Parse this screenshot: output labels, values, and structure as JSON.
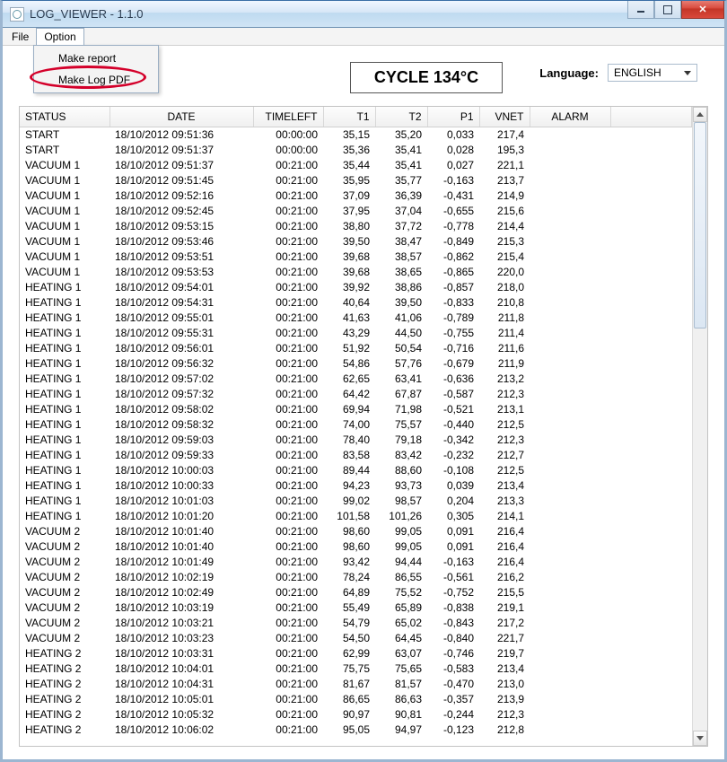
{
  "app": {
    "title": "LOG_VIEWER - 1.1.0"
  },
  "menu": {
    "file": "File",
    "option": "Option",
    "dropdown": {
      "make_report": "Make report",
      "make_log_pdf": "Make Log PDF"
    }
  },
  "header": {
    "cycle_label": "CYCLE 134°C",
    "language_label": "Language:",
    "language_value": "ENGLISH"
  },
  "columns": {
    "status": "STATUS",
    "date": "DATE",
    "timeleft": "TIMELEFT",
    "t1": "T1",
    "t2": "T2",
    "p1": "P1",
    "vnet": "VNET",
    "alarm": "ALARM"
  },
  "rows": [
    {
      "status": "START",
      "date": "18/10/2012 09:51:36",
      "timeleft": "00:00:00",
      "t1": "35,15",
      "t2": "35,20",
      "p1": "0,033",
      "vnet": "217,4",
      "alarm": ""
    },
    {
      "status": "START",
      "date": "18/10/2012 09:51:37",
      "timeleft": "00:00:00",
      "t1": "35,36",
      "t2": "35,41",
      "p1": "0,028",
      "vnet": "195,3",
      "alarm": ""
    },
    {
      "status": "VACUUM 1",
      "date": "18/10/2012 09:51:37",
      "timeleft": "00:21:00",
      "t1": "35,44",
      "t2": "35,41",
      "p1": "0,027",
      "vnet": "221,1",
      "alarm": ""
    },
    {
      "status": "VACUUM 1",
      "date": "18/10/2012 09:51:45",
      "timeleft": "00:21:00",
      "t1": "35,95",
      "t2": "35,77",
      "p1": "-0,163",
      "vnet": "213,7",
      "alarm": ""
    },
    {
      "status": "VACUUM 1",
      "date": "18/10/2012 09:52:16",
      "timeleft": "00:21:00",
      "t1": "37,09",
      "t2": "36,39",
      "p1": "-0,431",
      "vnet": "214,9",
      "alarm": ""
    },
    {
      "status": "VACUUM 1",
      "date": "18/10/2012 09:52:45",
      "timeleft": "00:21:00",
      "t1": "37,95",
      "t2": "37,04",
      "p1": "-0,655",
      "vnet": "215,6",
      "alarm": ""
    },
    {
      "status": "VACUUM 1",
      "date": "18/10/2012 09:53:15",
      "timeleft": "00:21:00",
      "t1": "38,80",
      "t2": "37,72",
      "p1": "-0,778",
      "vnet": "214,4",
      "alarm": ""
    },
    {
      "status": "VACUUM 1",
      "date": "18/10/2012 09:53:46",
      "timeleft": "00:21:00",
      "t1": "39,50",
      "t2": "38,47",
      "p1": "-0,849",
      "vnet": "215,3",
      "alarm": ""
    },
    {
      "status": "VACUUM 1",
      "date": "18/10/2012 09:53:51",
      "timeleft": "00:21:00",
      "t1": "39,68",
      "t2": "38,57",
      "p1": "-0,862",
      "vnet": "215,4",
      "alarm": ""
    },
    {
      "status": "VACUUM 1",
      "date": "18/10/2012 09:53:53",
      "timeleft": "00:21:00",
      "t1": "39,68",
      "t2": "38,65",
      "p1": "-0,865",
      "vnet": "220,0",
      "alarm": ""
    },
    {
      "status": "HEATING 1",
      "date": "18/10/2012 09:54:01",
      "timeleft": "00:21:00",
      "t1": "39,92",
      "t2": "38,86",
      "p1": "-0,857",
      "vnet": "218,0",
      "alarm": ""
    },
    {
      "status": "HEATING 1",
      "date": "18/10/2012 09:54:31",
      "timeleft": "00:21:00",
      "t1": "40,64",
      "t2": "39,50",
      "p1": "-0,833",
      "vnet": "210,8",
      "alarm": ""
    },
    {
      "status": "HEATING 1",
      "date": "18/10/2012 09:55:01",
      "timeleft": "00:21:00",
      "t1": "41,63",
      "t2": "41,06",
      "p1": "-0,789",
      "vnet": "211,8",
      "alarm": ""
    },
    {
      "status": "HEATING 1",
      "date": "18/10/2012 09:55:31",
      "timeleft": "00:21:00",
      "t1": "43,29",
      "t2": "44,50",
      "p1": "-0,755",
      "vnet": "211,4",
      "alarm": ""
    },
    {
      "status": "HEATING 1",
      "date": "18/10/2012 09:56:01",
      "timeleft": "00:21:00",
      "t1": "51,92",
      "t2": "50,54",
      "p1": "-0,716",
      "vnet": "211,6",
      "alarm": ""
    },
    {
      "status": "HEATING 1",
      "date": "18/10/2012 09:56:32",
      "timeleft": "00:21:00",
      "t1": "54,86",
      "t2": "57,76",
      "p1": "-0,679",
      "vnet": "211,9",
      "alarm": ""
    },
    {
      "status": "HEATING 1",
      "date": "18/10/2012 09:57:02",
      "timeleft": "00:21:00",
      "t1": "62,65",
      "t2": "63,41",
      "p1": "-0,636",
      "vnet": "213,2",
      "alarm": ""
    },
    {
      "status": "HEATING 1",
      "date": "18/10/2012 09:57:32",
      "timeleft": "00:21:00",
      "t1": "64,42",
      "t2": "67,87",
      "p1": "-0,587",
      "vnet": "212,3",
      "alarm": ""
    },
    {
      "status": "HEATING 1",
      "date": "18/10/2012 09:58:02",
      "timeleft": "00:21:00",
      "t1": "69,94",
      "t2": "71,98",
      "p1": "-0,521",
      "vnet": "213,1",
      "alarm": ""
    },
    {
      "status": "HEATING 1",
      "date": "18/10/2012 09:58:32",
      "timeleft": "00:21:00",
      "t1": "74,00",
      "t2": "75,57",
      "p1": "-0,440",
      "vnet": "212,5",
      "alarm": ""
    },
    {
      "status": "HEATING 1",
      "date": "18/10/2012 09:59:03",
      "timeleft": "00:21:00",
      "t1": "78,40",
      "t2": "79,18",
      "p1": "-0,342",
      "vnet": "212,3",
      "alarm": ""
    },
    {
      "status": "HEATING 1",
      "date": "18/10/2012 09:59:33",
      "timeleft": "00:21:00",
      "t1": "83,58",
      "t2": "83,42",
      "p1": "-0,232",
      "vnet": "212,7",
      "alarm": ""
    },
    {
      "status": "HEATING 1",
      "date": "18/10/2012 10:00:03",
      "timeleft": "00:21:00",
      "t1": "89,44",
      "t2": "88,60",
      "p1": "-0,108",
      "vnet": "212,5",
      "alarm": ""
    },
    {
      "status": "HEATING 1",
      "date": "18/10/2012 10:00:33",
      "timeleft": "00:21:00",
      "t1": "94,23",
      "t2": "93,73",
      "p1": "0,039",
      "vnet": "213,4",
      "alarm": ""
    },
    {
      "status": "HEATING 1",
      "date": "18/10/2012 10:01:03",
      "timeleft": "00:21:00",
      "t1": "99,02",
      "t2": "98,57",
      "p1": "0,204",
      "vnet": "213,3",
      "alarm": ""
    },
    {
      "status": "HEATING 1",
      "date": "18/10/2012 10:01:20",
      "timeleft": "00:21:00",
      "t1": "101,58",
      "t2": "101,26",
      "p1": "0,305",
      "vnet": "214,1",
      "alarm": ""
    },
    {
      "status": "VACUUM 2",
      "date": "18/10/2012 10:01:40",
      "timeleft": "00:21:00",
      "t1": "98,60",
      "t2": "99,05",
      "p1": "0,091",
      "vnet": "216,4",
      "alarm": ""
    },
    {
      "status": "VACUUM 2",
      "date": "18/10/2012 10:01:40",
      "timeleft": "00:21:00",
      "t1": "98,60",
      "t2": "99,05",
      "p1": "0,091",
      "vnet": "216,4",
      "alarm": ""
    },
    {
      "status": "VACUUM 2",
      "date": "18/10/2012 10:01:49",
      "timeleft": "00:21:00",
      "t1": "93,42",
      "t2": "94,44",
      "p1": "-0,163",
      "vnet": "216,4",
      "alarm": ""
    },
    {
      "status": "VACUUM 2",
      "date": "18/10/2012 10:02:19",
      "timeleft": "00:21:00",
      "t1": "78,24",
      "t2": "86,55",
      "p1": "-0,561",
      "vnet": "216,2",
      "alarm": ""
    },
    {
      "status": "VACUUM 2",
      "date": "18/10/2012 10:02:49",
      "timeleft": "00:21:00",
      "t1": "64,89",
      "t2": "75,52",
      "p1": "-0,752",
      "vnet": "215,5",
      "alarm": ""
    },
    {
      "status": "VACUUM 2",
      "date": "18/10/2012 10:03:19",
      "timeleft": "00:21:00",
      "t1": "55,49",
      "t2": "65,89",
      "p1": "-0,838",
      "vnet": "219,1",
      "alarm": ""
    },
    {
      "status": "VACUUM 2",
      "date": "18/10/2012 10:03:21",
      "timeleft": "00:21:00",
      "t1": "54,79",
      "t2": "65,02",
      "p1": "-0,843",
      "vnet": "217,2",
      "alarm": ""
    },
    {
      "status": "VACUUM 2",
      "date": "18/10/2012 10:03:23",
      "timeleft": "00:21:00",
      "t1": "54,50",
      "t2": "64,45",
      "p1": "-0,840",
      "vnet": "221,7",
      "alarm": ""
    },
    {
      "status": "HEATING 2",
      "date": "18/10/2012 10:03:31",
      "timeleft": "00:21:00",
      "t1": "62,99",
      "t2": "63,07",
      "p1": "-0,746",
      "vnet": "219,7",
      "alarm": ""
    },
    {
      "status": "HEATING 2",
      "date": "18/10/2012 10:04:01",
      "timeleft": "00:21:00",
      "t1": "75,75",
      "t2": "75,65",
      "p1": "-0,583",
      "vnet": "213,4",
      "alarm": ""
    },
    {
      "status": "HEATING 2",
      "date": "18/10/2012 10:04:31",
      "timeleft": "00:21:00",
      "t1": "81,67",
      "t2": "81,57",
      "p1": "-0,470",
      "vnet": "213,0",
      "alarm": ""
    },
    {
      "status": "HEATING 2",
      "date": "18/10/2012 10:05:01",
      "timeleft": "00:21:00",
      "t1": "86,65",
      "t2": "86,63",
      "p1": "-0,357",
      "vnet": "213,9",
      "alarm": ""
    },
    {
      "status": "HEATING 2",
      "date": "18/10/2012 10:05:32",
      "timeleft": "00:21:00",
      "t1": "90,97",
      "t2": "90,81",
      "p1": "-0,244",
      "vnet": "212,3",
      "alarm": ""
    },
    {
      "status": "HEATING 2",
      "date": "18/10/2012 10:06:02",
      "timeleft": "00:21:00",
      "t1": "95,05",
      "t2": "94,97",
      "p1": "-0,123",
      "vnet": "212,8",
      "alarm": ""
    }
  ]
}
